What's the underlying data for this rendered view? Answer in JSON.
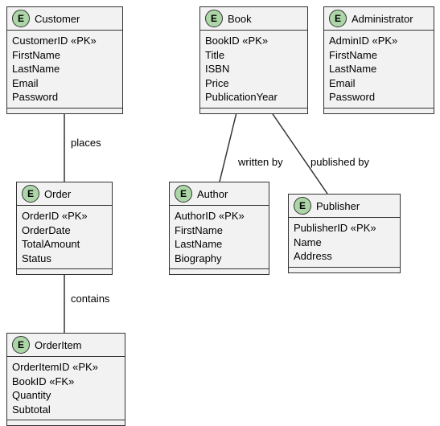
{
  "stereotype_letter": "E",
  "entities": {
    "customer": {
      "name": "Customer",
      "attrs": [
        "CustomerID «PK»",
        "FirstName",
        "LastName",
        "Email",
        "Password"
      ]
    },
    "book": {
      "name": "Book",
      "attrs": [
        "BookID «PK»",
        "Title",
        "ISBN",
        "Price",
        "PublicationYear"
      ]
    },
    "administrator": {
      "name": "Administrator",
      "attrs": [
        "AdminID «PK»",
        "FirstName",
        "LastName",
        "Email",
        "Password"
      ]
    },
    "order": {
      "name": "Order",
      "attrs": [
        "OrderID «PK»",
        "OrderDate",
        "TotalAmount",
        "Status"
      ]
    },
    "author": {
      "name": "Author",
      "attrs": [
        "AuthorID «PK»",
        "FirstName",
        "LastName",
        "Biography"
      ]
    },
    "publisher": {
      "name": "Publisher",
      "attrs": [
        "PublisherID «PK»",
        "Name",
        "Address"
      ]
    },
    "orderitem": {
      "name": "OrderItem",
      "attrs": [
        "OrderItemID «PK»",
        "BookID «FK»",
        "Quantity",
        "Subtotal"
      ]
    }
  },
  "relations": {
    "places": "places",
    "contains": "contains",
    "written_by": "written by",
    "published_by": "published by"
  }
}
